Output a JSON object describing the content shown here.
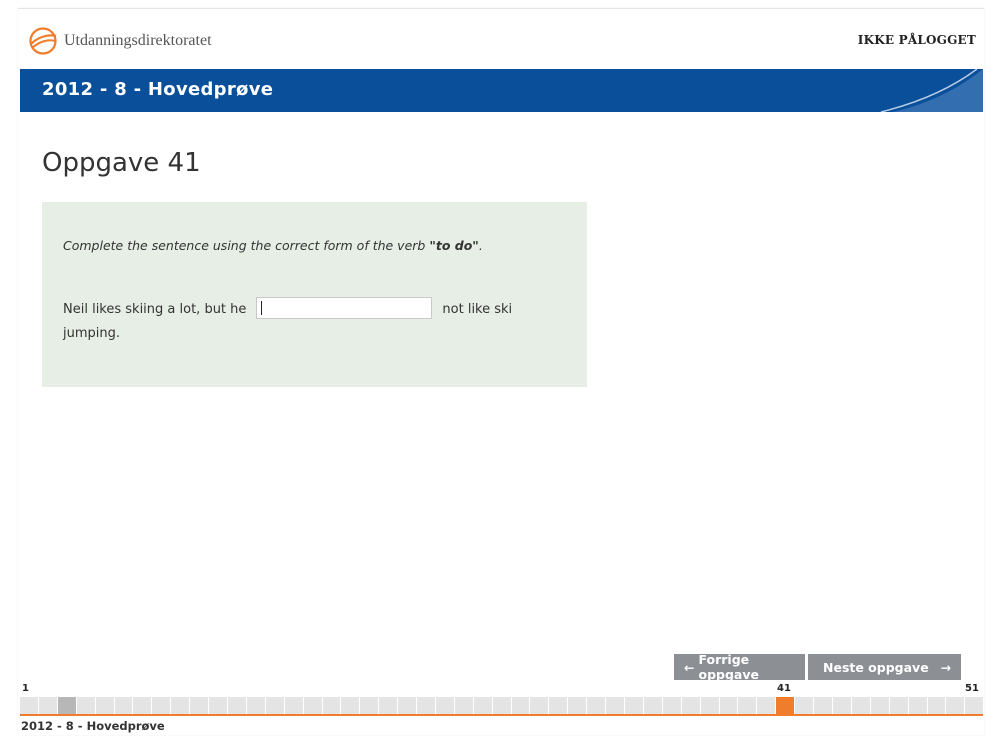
{
  "header": {
    "org_name": "Utdanningsdirektoratet",
    "login_status": "IKKE PÅLOGGET"
  },
  "test_title": "2012 - 8 - Hovedprøve",
  "question": {
    "title": "Oppgave 41",
    "instruction_prefix": "Complete the sentence using the correct form of the verb ",
    "instruction_verb": "\"to do\"",
    "instruction_suffix": ".",
    "sentence_before": "Neil likes skiing a lot, but he",
    "answer_value": "",
    "sentence_after": "not like ski jumping."
  },
  "navigation": {
    "prev_label": "Forrige oppgave",
    "next_label": "Neste oppgave",
    "prev_icon": "arrow-left-icon",
    "next_icon": "arrow-right-icon"
  },
  "progress": {
    "first": "1",
    "current": "41",
    "last": "51",
    "total": 51,
    "current_index": 41,
    "seen": [
      3
    ]
  },
  "footer": {
    "test_title": "2012 - 8 - Hovedprøve"
  },
  "colors": {
    "brand_blue": "#0a4f9a",
    "accent_orange": "#f07d2c",
    "question_bg": "#e7eee6",
    "button_grey": "#8c9094"
  }
}
